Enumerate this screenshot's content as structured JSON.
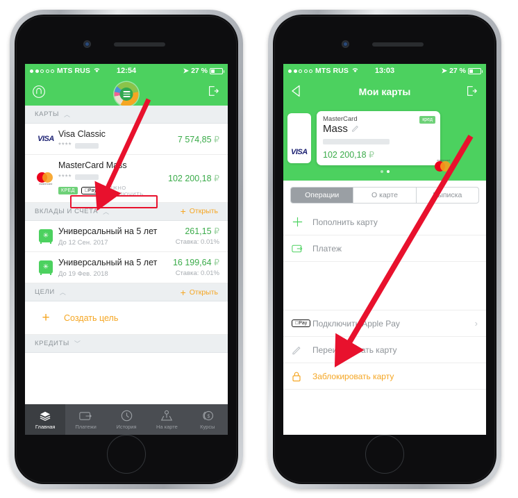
{
  "meta": {
    "app": "Sberbank Online iOS",
    "accent_green": "#4CD15F",
    "accent_orange": "#F5A623",
    "annotation_red": "#e8112d"
  },
  "left_phone": {
    "status_bar": {
      "signal_dots": "••ooo",
      "carrier": "MTS RUS",
      "wifi_icon": "wifi-icon",
      "time": "12:54",
      "location_icon": "location-arrow-icon",
      "battery": "27 %"
    },
    "navbar": {
      "left_icon": "profile-icon",
      "center_icon": "avatar-chart-icon",
      "right_icon": "logout-icon"
    },
    "sections": [
      {
        "title": "КАРТЫ",
        "collapse_icon": "chevron-up-icon",
        "action": null,
        "rows": [
          {
            "icon": "visa-logo-icon",
            "name": "Visa Classic",
            "mask": "****",
            "amount": "7 574,85",
            "currency": "₽",
            "badges": []
          },
          {
            "icon": "mastercard-logo-icon",
            "name": "MasterCard Mass",
            "mask": "****",
            "amount": "102 200,18",
            "currency": "₽",
            "badges": [
              {
                "type": "kred",
                "label": "КРЕД"
              },
              {
                "type": "applepay",
                "label": "Pay",
                "hint": "МОЖНО ПОДКЛЮЧИТЬ"
              }
            ]
          }
        ]
      },
      {
        "title": "ВКЛАДЫ И СЧЕТА",
        "collapse_icon": "chevron-up-icon",
        "action": {
          "icon": "plus-icon",
          "label": "Открыть"
        },
        "rows": [
          {
            "icon": "safe-icon",
            "name": "Универсальный на 5 лет",
            "sub": "До 12 Сен. 2017",
            "amount": "261,15",
            "currency": "₽",
            "rate": "Ставка: 0.01%"
          },
          {
            "icon": "safe-icon",
            "name": "Универсальный на 5 лет",
            "sub": "До 19 Фев. 2018",
            "amount": "16 199,64",
            "currency": "₽",
            "rate": "Ставка: 0.01%"
          }
        ]
      },
      {
        "title": "ЦЕЛИ",
        "collapse_icon": "chevron-up-icon",
        "action": {
          "icon": "plus-icon",
          "label": "Открыть"
        },
        "create": {
          "icon": "plus-icon",
          "label": "Создать цель"
        }
      },
      {
        "title": "КРЕДИТЫ",
        "collapse_icon": "chevron-down-icon",
        "action": null
      }
    ],
    "tabbar": [
      {
        "icon": "home-stack-icon",
        "label": "Главная",
        "active": true
      },
      {
        "icon": "payments-card-icon",
        "label": "Платежи",
        "active": false
      },
      {
        "icon": "history-clock-icon",
        "label": "История",
        "active": false
      },
      {
        "icon": "map-pin-icon",
        "label": "На карте",
        "active": false
      },
      {
        "icon": "rates-dollar-icon",
        "label": "Курсы",
        "active": false
      }
    ]
  },
  "right_phone": {
    "status_bar": {
      "signal_dots": "••ooo",
      "carrier": "MTS RUS",
      "wifi_icon": "wifi-icon",
      "time": "13:03",
      "location_icon": "location-arrow-icon",
      "battery": "27 %"
    },
    "navbar": {
      "back_icon": "back-triangle-icon",
      "title": "Мои карты",
      "right_icon": "logout-icon"
    },
    "card": {
      "peek_logo": "visa-logo-icon",
      "type": "MasterCard",
      "name": "Mass",
      "edit_icon": "pencil-icon",
      "badge": "кред",
      "amount": "102 200,18",
      "currency": "₽",
      "brand_icon": "mastercard-logo-icon",
      "pager": {
        "count": 2,
        "active_index": 1
      }
    },
    "tabs": [
      {
        "label": "Операции",
        "active": true
      },
      {
        "label": "О карте",
        "active": false
      },
      {
        "label": "Выписка",
        "active": false
      }
    ],
    "actions": [
      {
        "icon": "plus-icon",
        "label": "Пополнить карту",
        "chevron": false,
        "style": "normal"
      },
      {
        "icon": "payment-card-arrow-icon",
        "label": "Платеж",
        "chevron": false,
        "style": "normal"
      },
      {
        "icon": "apple-pay-icon",
        "label": "Подключить Apple Pay",
        "chevron": true,
        "style": "normal"
      },
      {
        "icon": "pencil-icon",
        "label": "Переименовать карту",
        "chevron": false,
        "style": "normal"
      },
      {
        "icon": "lock-icon",
        "label": "Заблокировать карту",
        "chevron": false,
        "style": "orange"
      }
    ]
  }
}
